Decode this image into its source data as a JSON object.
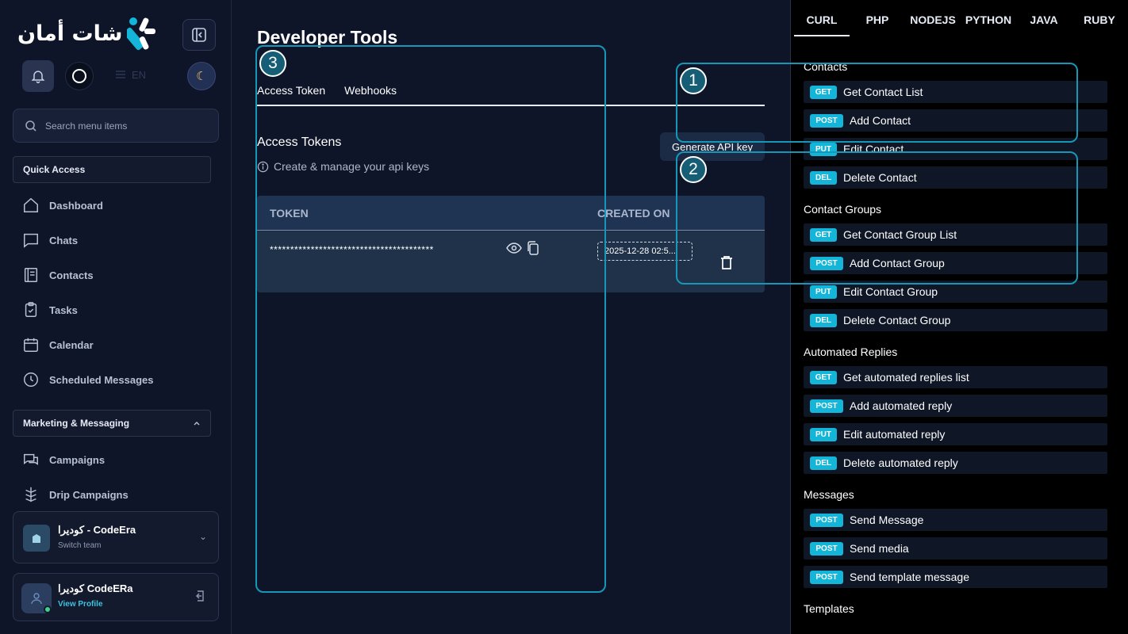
{
  "sidebar": {
    "logo_text": "شات أمان",
    "lang_label": "EN",
    "search_placeholder": "Search menu items",
    "quick_access": "Quick Access",
    "nav": [
      {
        "label": "Dashboard",
        "icon": "home-icon"
      },
      {
        "label": "Chats",
        "icon": "chat-icon"
      },
      {
        "label": "Contacts",
        "icon": "contacts-icon"
      },
      {
        "label": "Tasks",
        "icon": "clipboard-icon"
      },
      {
        "label": "Calendar",
        "icon": "calendar-icon"
      },
      {
        "label": "Scheduled Messages",
        "icon": "clock-icon"
      }
    ],
    "marketing_section": "Marketing & Messaging",
    "marketing_nav": [
      {
        "label": "Campaigns",
        "icon": "campaigns-icon"
      },
      {
        "label": "Drip Campaigns",
        "icon": "drip-icon"
      }
    ],
    "team": {
      "name": "كوديرا - CodeEra",
      "sub": "Switch team"
    },
    "profile": {
      "name": "كوديرا CodeERa",
      "link": "View Profile"
    }
  },
  "main": {
    "title": "Developer Tools",
    "tabs": [
      "Access Token",
      "Webhooks"
    ],
    "section_title": "Access Tokens",
    "section_sub": "Create & manage your api keys",
    "generate_button": "Generate API key",
    "table": {
      "headers": [
        "TOKEN",
        "CREATED ON"
      ],
      "rows": [
        {
          "token": "****************************************",
          "created": "2025-12-28 02:5..."
        }
      ]
    }
  },
  "right_panel": {
    "languages": [
      "CURL",
      "PHP",
      "NODEJS",
      "PYTHON",
      "JAVA",
      "RUBY"
    ],
    "active_language": "CURL",
    "groups": [
      {
        "title": "Contacts",
        "endpoints": [
          {
            "method": "GET",
            "label": "Get Contact List"
          },
          {
            "method": "POST",
            "label": "Add Contact"
          },
          {
            "method": "PUT",
            "label": "Edit Contact"
          },
          {
            "method": "DEL",
            "label": "Delete Contact"
          }
        ]
      },
      {
        "title": "Contact Groups",
        "endpoints": [
          {
            "method": "GET",
            "label": "Get Contact Group List"
          },
          {
            "method": "POST",
            "label": "Add Contact Group"
          },
          {
            "method": "PUT",
            "label": "Edit Contact Group"
          },
          {
            "method": "DEL",
            "label": "Delete Contact Group"
          }
        ]
      },
      {
        "title": "Automated Replies",
        "endpoints": [
          {
            "method": "GET",
            "label": "Get automated replies list"
          },
          {
            "method": "POST",
            "label": "Add automated reply"
          },
          {
            "method": "PUT",
            "label": "Edit automated reply"
          },
          {
            "method": "DEL",
            "label": "Delete automated reply"
          }
        ]
      },
      {
        "title": "Messages",
        "endpoints": [
          {
            "method": "POST",
            "label": "Send Message"
          },
          {
            "method": "POST",
            "label": "Send media"
          },
          {
            "method": "POST",
            "label": "Send template message"
          }
        ]
      },
      {
        "title": "Templates",
        "endpoints": []
      }
    ]
  },
  "highlights": [
    {
      "number": "1"
    },
    {
      "number": "2"
    },
    {
      "number": "3"
    }
  ],
  "colors": {
    "accent": "#13b5d8",
    "highlight": "#1797b8",
    "background": "#0f1529"
  }
}
